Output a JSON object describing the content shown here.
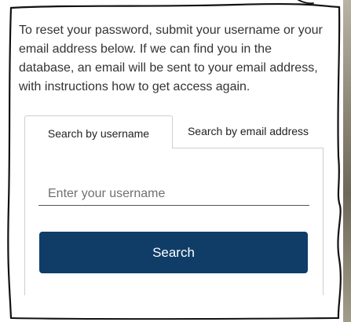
{
  "intro": {
    "text": "To reset your password, submit your username or your email address below. If we can find you in the database, an email will be sent to your email address, with instructions how to get access again."
  },
  "tabs": [
    {
      "label": "Search by username",
      "active": true
    },
    {
      "label": "Search by email address",
      "active": false
    }
  ],
  "form": {
    "username_placeholder": "Enter your username",
    "search_label": "Search"
  },
  "colors": {
    "button": "#0f3d68",
    "text": "#333333"
  }
}
